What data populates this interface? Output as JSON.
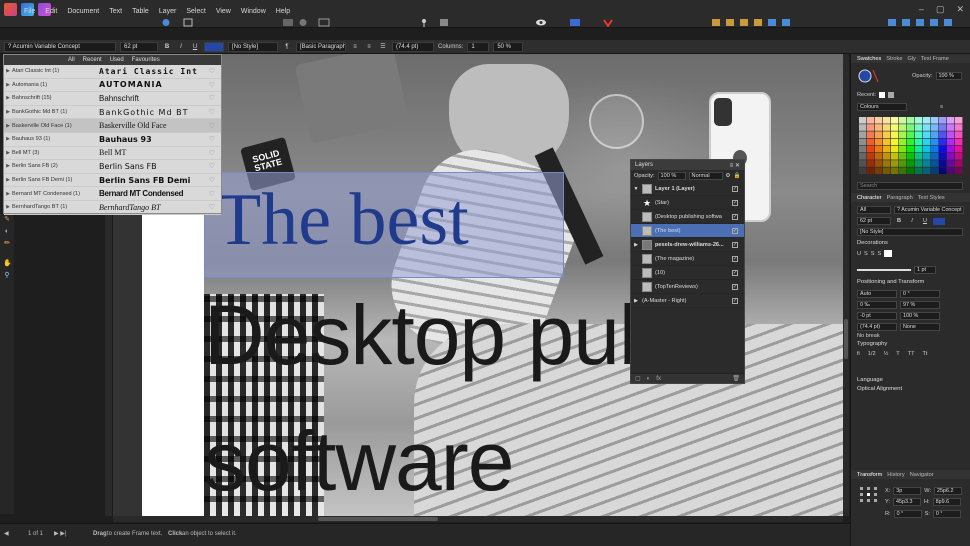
{
  "menu": [
    "File",
    "Edit",
    "Document",
    "Text",
    "Table",
    "Layer",
    "Select",
    "View",
    "Window",
    "Help"
  ],
  "window_controls": [
    "–",
    "▢",
    "✕"
  ],
  "context_bar": {
    "font_family": "? Acumin Variable Concept",
    "font_size": "62 pt",
    "char_style": "[No Style]",
    "para_style": "[Basic Paragraph]",
    "leading": "(74.4 pt)",
    "columns_label": "Columns:",
    "columns_value": "1",
    "gutter": "50 %"
  },
  "font_panel": {
    "tabs": [
      "All",
      "Recent",
      "Used",
      "Favourites"
    ],
    "fonts": [
      {
        "name": "Atari Classic Int (1)",
        "sample": "Atari Classic Int"
      },
      {
        "name": "Automania (1)",
        "sample": "AUTOMANIA"
      },
      {
        "name": "Bahnschrift (15)",
        "sample": "Bahnschrift"
      },
      {
        "name": "BankGothic Md BT (1)",
        "sample": "BankGothic Md BT"
      },
      {
        "name": "Baskerville Old Face (1)",
        "sample": "Baskerville Old Face"
      },
      {
        "name": "Bauhaus 93 (1)",
        "sample": "Bauhaus 93"
      },
      {
        "name": "Bell MT (3)",
        "sample": "Bell MT"
      },
      {
        "name": "Berlin Sans FB (2)",
        "sample": "Berlin Sans FB"
      },
      {
        "name": "Berlin Sans FB Demi (1)",
        "sample": "Berlin Sans FB Demi"
      },
      {
        "name": "Bernard MT Condensed (1)",
        "sample": "Bernard MT Condensed"
      },
      {
        "name": "BernhardTango BT (1)",
        "sample": "BernhardTango BT"
      }
    ],
    "selected_index": 4
  },
  "canvas": {
    "badge_text": "SOLID STATE",
    "headline": "The best",
    "body_line1": "Desktop publis",
    "body_line2": "software"
  },
  "layers_panel": {
    "title": "Layers",
    "opacity_label": "Opacity:",
    "opacity_value": "100 %",
    "blend_mode": "Normal",
    "rows": [
      {
        "name": "Layer 1 (Layer)",
        "bold": true
      },
      {
        "name": "(Star)"
      },
      {
        "name": "(Desktop publishing softwa"
      },
      {
        "name": "(The best)",
        "active": true
      },
      {
        "name": "pexels-drew-williams-26...",
        "bold": true
      },
      {
        "name": "(The magazine)"
      },
      {
        "name": "(10)"
      },
      {
        "name": "(TopTenReviews)"
      },
      {
        "name": "(A-Master - Right)"
      }
    ]
  },
  "right_panel": {
    "top_tabs": [
      "Swatches",
      "Stroke",
      "Gly",
      "Text Frame"
    ],
    "opacity_label": "Opacity:",
    "opacity_value": "100 %",
    "recent_label": "Recent:",
    "palette": "Colours",
    "search_placeholder": "Search",
    "char_tabs": [
      "Character",
      "Paragraph",
      "Text Styles"
    ],
    "char_filter": "All",
    "char_font": "? Acumin Variable Concept",
    "char_size": "62 pt",
    "char_style": "[No Style]",
    "decorations_label": "Decorations",
    "stroke_width": "1 pt",
    "positioning_label": "Positioning and Transform",
    "kerning": "Auto",
    "tracking": "0 ‰",
    "baseline": "-0 pt",
    "leading": "(74.4 pt)",
    "angle": "0 °",
    "hscale": "97 %",
    "vscale": "100 %",
    "nobreak": "No break",
    "none": "None",
    "typography_label": "Typography",
    "typography_buttons": [
      "fi",
      "1/2",
      "½",
      "T",
      "TT",
      "Tt"
    ],
    "language_label": "Language",
    "optical_label": "Optical Alignment",
    "transform_tabs": [
      "Transform",
      "History",
      "Navigator"
    ],
    "x": "3p",
    "y": "45p3.3",
    "w": "25p6.2",
    "h": "8p9.6",
    "r": "0 °",
    "s": "0 °"
  },
  "status": {
    "page": "1 of 1",
    "hint_bold1": "Drag",
    "hint1": "to create Frame text.",
    "hint_bold2": "Click",
    "hint2": "an object to select it."
  },
  "colors": {
    "accent": "#4a6fb5",
    "headline": "#203a8c",
    "selection": "#96a0d2"
  }
}
